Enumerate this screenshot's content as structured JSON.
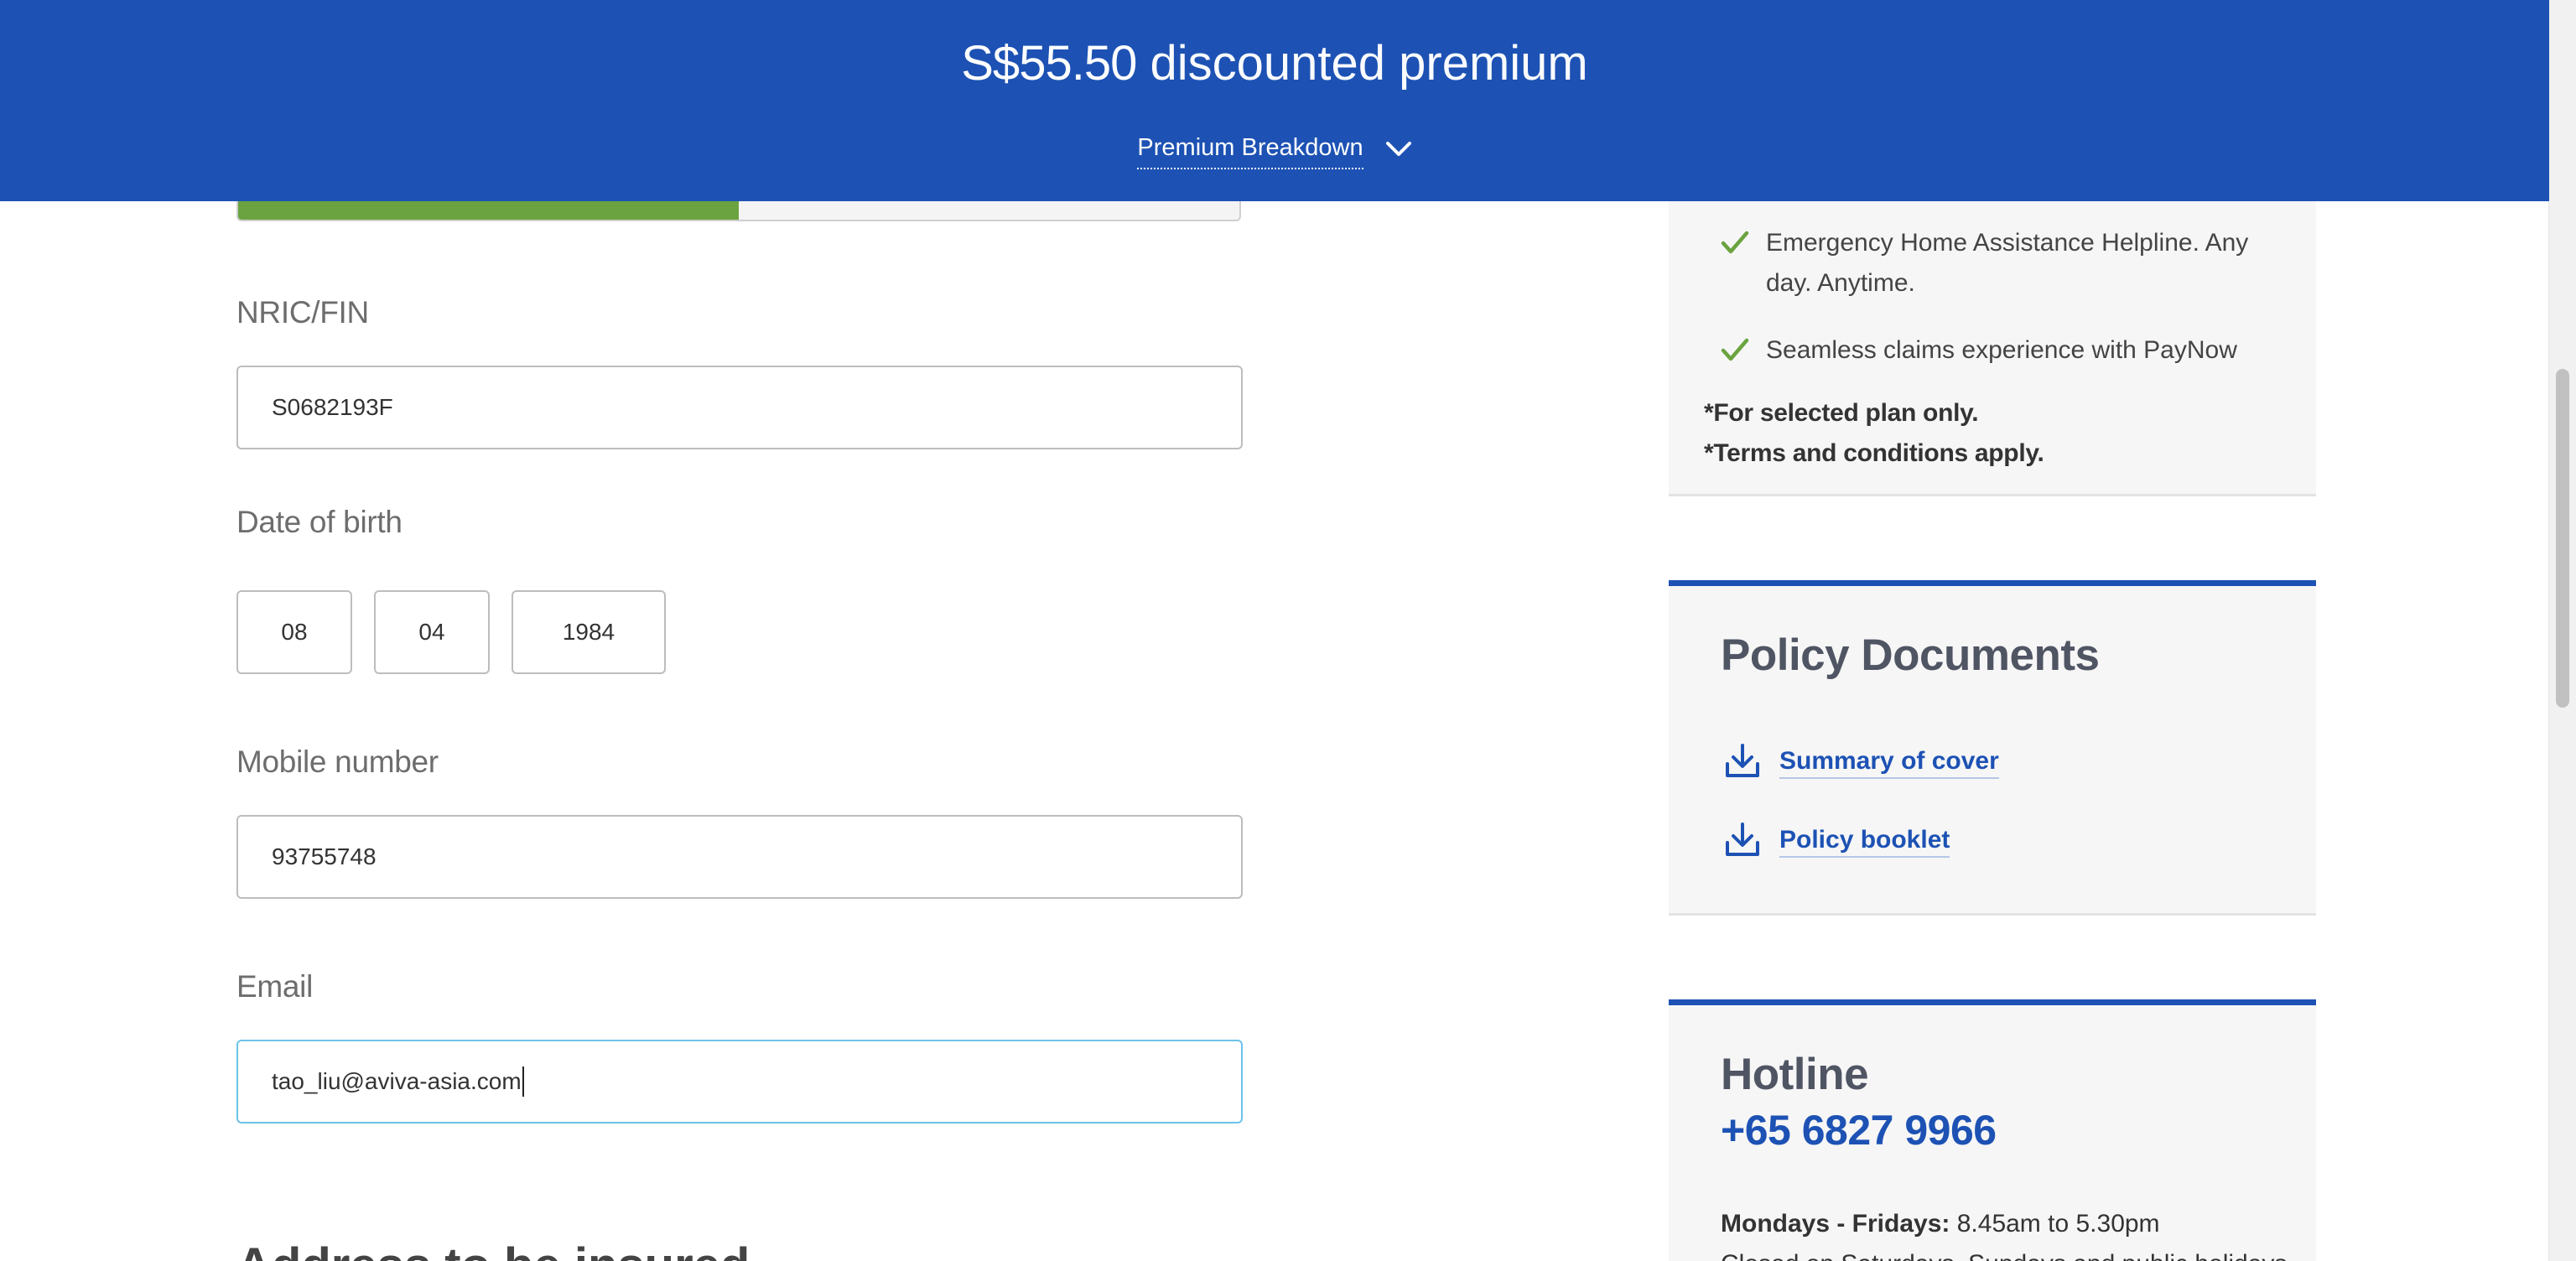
{
  "banner": {
    "amount": "S$55.50",
    "label": "discounted premium",
    "breakdown_label": "Premium Breakdown",
    "color": "#1d52b4"
  },
  "progress": {
    "fraction": 0.5,
    "fill_color": "#6aa33f"
  },
  "form": {
    "nric": {
      "label": "NRIC/FIN",
      "value": "S0682193F"
    },
    "dob": {
      "label": "Date of birth",
      "day": "08",
      "month": "04",
      "year": "1984"
    },
    "mobile": {
      "label": "Mobile number",
      "value": "93755748"
    },
    "email": {
      "label": "Email",
      "value": "tao_liu@aviva-asia.com"
    },
    "next_section_heading": "Address to be insured"
  },
  "benefits": {
    "items": [
      {
        "icon": "check-icon",
        "text": "Emergency Home Assistance Helpline. Any day. Anytime."
      },
      {
        "icon": "check-icon",
        "text": "Seamless claims experience with PayNow"
      }
    ],
    "note_1": "*For selected plan only.",
    "note_2": "*Terms and conditions apply."
  },
  "policy_documents": {
    "title": "Policy Documents",
    "links": [
      {
        "icon": "download-icon",
        "label": "Summary of cover"
      },
      {
        "icon": "download-icon",
        "label": "Policy booklet"
      }
    ]
  },
  "hotline": {
    "title": "Hotline",
    "number": "+65 6827 9966",
    "hours_label": "Mondays - Fridays:",
    "hours_value": "8.45am to 5.30pm",
    "closed_text": "Closed on Saturdays, Sundays and public holidays."
  }
}
